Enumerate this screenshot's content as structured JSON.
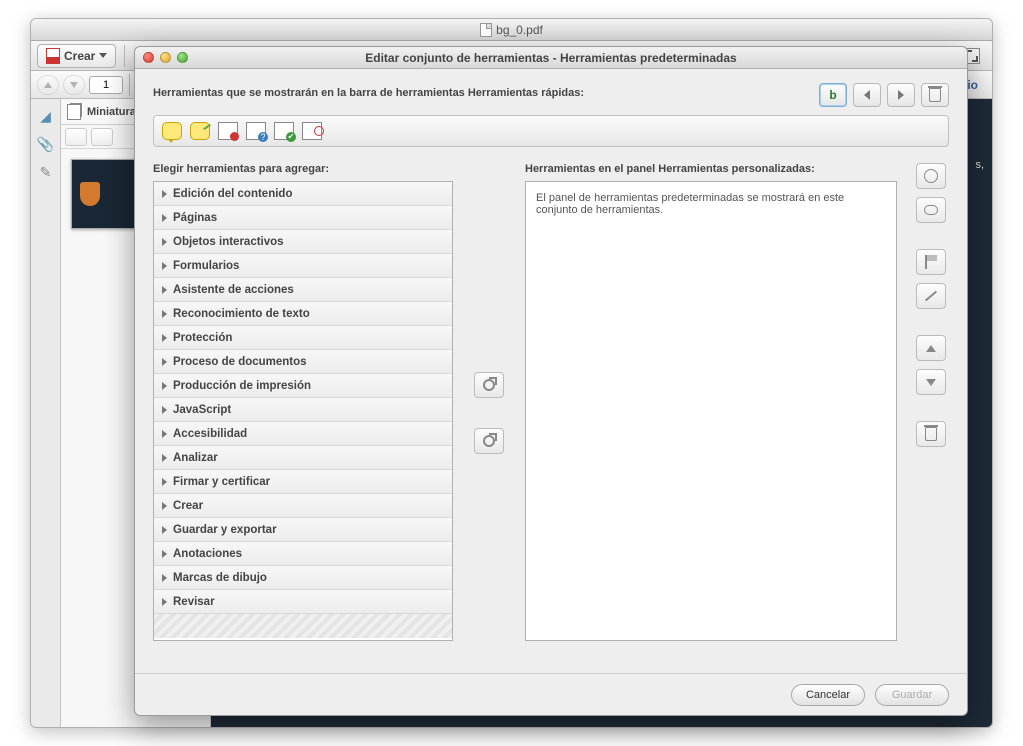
{
  "window": {
    "document_title": "bg_0.pdf",
    "crear_label": "Crear",
    "page_number": "1",
    "right_panel_fragment": "ntario"
  },
  "thumbnails_panel": {
    "title": "Miniaturas"
  },
  "doc_snippet": "s,",
  "dialog": {
    "title": "Editar conjunto de herramientas - Herramientas predeterminadas",
    "prompt": "Herramientas que se mostrarán en la barra de herramientas Herramientas rápidas:",
    "left_heading": "Elegir herramientas para agregar:",
    "right_heading": "Herramientas en el panel Herramientas personalizadas:",
    "right_message": "El panel de herramientas predeterminadas se mostrará en este conjunto de herramientas.",
    "categories": [
      "Edición del contenido",
      "Páginas",
      "Objetos interactivos",
      "Formularios",
      "Asistente de acciones",
      "Reconocimiento de texto",
      "Protección",
      "Proceso de documentos",
      "Producción de impresión",
      "JavaScript",
      "Accesibilidad",
      "Analizar",
      "Firmar y certificar",
      "Crear",
      "Guardar y exportar",
      "Anotaciones",
      "Marcas de dibujo",
      "Revisar"
    ],
    "cancel": "Cancelar",
    "save": "Guardar"
  }
}
